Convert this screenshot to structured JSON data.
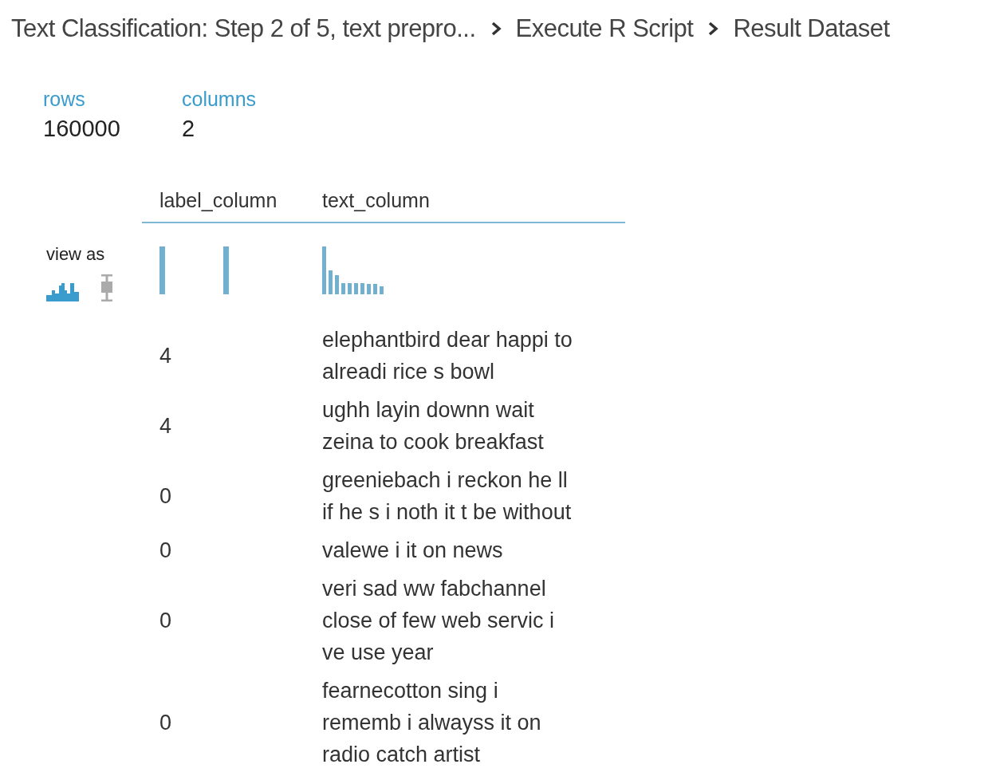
{
  "breadcrumb": [
    "Text Classification: Step 2 of 5, text prepro...",
    "Execute R Script",
    "Result Dataset"
  ],
  "stats": [
    {
      "label": "rows",
      "value": "160000"
    },
    {
      "label": "columns",
      "value": "2"
    }
  ],
  "view_as": {
    "label": "view as",
    "modes": [
      {
        "kind": "histogram",
        "selected": true
      },
      {
        "kind": "boxplot",
        "selected": false
      }
    ]
  },
  "table": {
    "columns": [
      "label_column",
      "text_column"
    ],
    "histograms": [
      {
        "kind": "two-bars"
      },
      {
        "kind": "decay"
      }
    ],
    "rows": [
      {
        "label": "4",
        "text": [
          "elephantbird dear happi to",
          "alreadi rice s bowl"
        ]
      },
      {
        "label": "4",
        "text": [
          "ughh layin downn wait",
          "zeina to cook breakfast"
        ]
      },
      {
        "label": "0",
        "text": [
          "greeniebach i reckon he ll",
          "if he s i noth it t be without"
        ]
      },
      {
        "label": "0",
        "text": [
          "valewe i it on news"
        ]
      },
      {
        "label": "0",
        "text": [
          "veri sad ww fabchannel",
          "close of few web servic i",
          "ve use year"
        ]
      },
      {
        "label": "0",
        "text": [
          "fearnecotton sing i",
          "rememb i alwayss it on",
          "radio catch artist"
        ]
      }
    ]
  }
}
